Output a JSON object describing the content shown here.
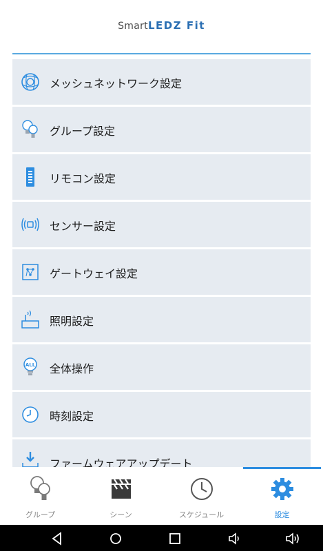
{
  "header": {
    "logo_prefix": "Smart",
    "logo_brand": "LEDZ Fit"
  },
  "menu": {
    "items": [
      {
        "label": "メッシュネットワーク設定",
        "icon": "mesh-network-icon"
      },
      {
        "label": "グループ設定",
        "icon": "group-bulbs-icon"
      },
      {
        "label": "リモコン設定",
        "icon": "remote-control-icon"
      },
      {
        "label": "センサー設定",
        "icon": "sensor-icon"
      },
      {
        "label": "ゲートウェイ設定",
        "icon": "gateway-icon"
      },
      {
        "label": "照明設定",
        "icon": "lighting-icon"
      },
      {
        "label": "全体操作",
        "icon": "all-bulb-icon"
      },
      {
        "label": "時刻設定",
        "icon": "clock-icon"
      },
      {
        "label": "ファームウェアアップデート",
        "icon": "download-icon"
      }
    ]
  },
  "tabs": [
    {
      "label": "グループ",
      "icon": "group-bulbs-icon",
      "active": false
    },
    {
      "label": "シーン",
      "icon": "clapperboard-icon",
      "active": false
    },
    {
      "label": "スケジュール",
      "icon": "clock-icon",
      "active": false
    },
    {
      "label": "設定",
      "icon": "gear-icon",
      "active": true
    }
  ],
  "colors": {
    "accent": "#2d8de0",
    "item_bg": "#e6ebf1",
    "header_line": "#5aa9e0"
  }
}
